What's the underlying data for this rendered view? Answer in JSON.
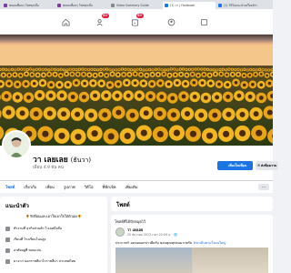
{
  "browser": {
    "tabs": [
      {
        "title": "พลอยเพื่อนๆ โพสทุกเมื่อ",
        "favicon_color": "#7b3fa0",
        "active": false
      },
      {
        "title": "พลอยเพื่อนๆ โพสทุกเมื่อ",
        "favicon_color": "#7b3fa0",
        "active": false
      },
      {
        "title": "Video Summary Guide",
        "favicon_color": "#888888",
        "active": false
      },
      {
        "title": "(1) วา | Facebook",
        "favicon_color": "#1877f2",
        "active": true
      },
      {
        "title": "(1) วิดีโอแนะนำเครื่องจักร",
        "favicon_color": "#1877f2",
        "active": false
      }
    ]
  },
  "nav": {
    "home_icon": "home-icon",
    "friends_badge": "9+",
    "marketplace_badge": "9+",
    "profile_icon": "profile-icon",
    "groups_icon": "groups-icon"
  },
  "profile": {
    "name": "วา เลยเลย",
    "alt_name": "(ธันวา)",
    "friends_text": "เพื่อน 4.9 พัน คน",
    "add_friend_label": "เพิ่มเป็นเพื่อน",
    "message_label": "ส่งข้อความ"
  },
  "profile_tabs": [
    "โพสต์",
    "เกี่ยวกับ",
    "เพื่อน",
    "รูปภาพ",
    "วิดีโอ",
    "ที่พักเช็ค",
    "เพิ่มเติม"
  ],
  "intro": {
    "title": "แนะนำตัว",
    "bio": "🌻รักพื่อนและเอาใจเอาใจใส่ตัวเอง🌻",
    "rows": [
      "ทำงานที่ ธุรกิจส่วนตัว ไวเลสมือถือ",
      "เรียนที่ โรงเรียนโนนสูง",
      "อาศัยอยู่ที่ ขอนแก่น",
      "มาจาก นครราชสีมาโกราชสีมา ประเทศไทย"
    ]
  },
  "posts": {
    "header": "โพสต์",
    "label": "โพสต์ที่ได้ปักหมุดไว้",
    "author": "วา เลยเลย",
    "date": "25 ธันวาคม 2022 เวลา 22:09 น. · 🌐",
    "text": "ประกาศ!! ผมขอบอกข่าวดีครับ ขอบคุณทุกคนมากครับ",
    "link_text": "#พาเดินตามใจคนใหญ่"
  }
}
